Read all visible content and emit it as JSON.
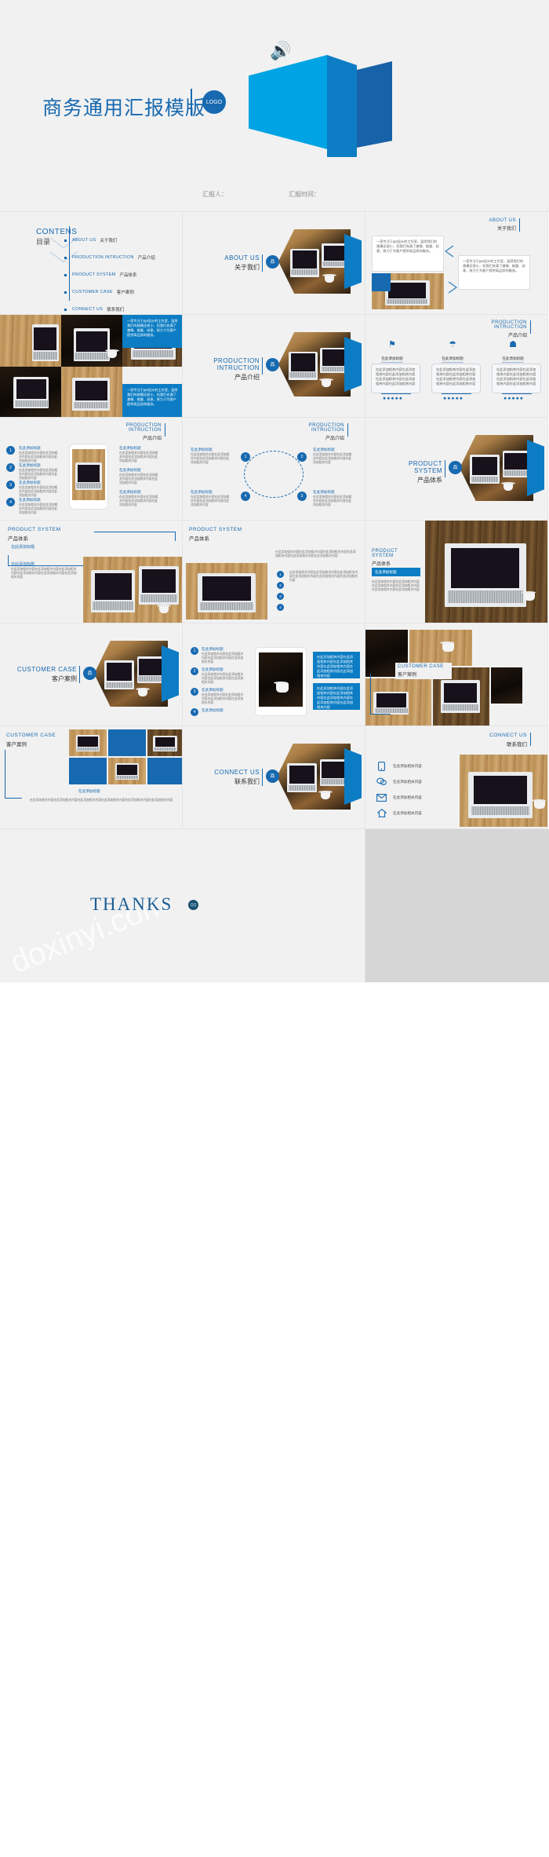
{
  "brand": {
    "accent": "#1769b0",
    "cyan": "#00a4e4",
    "mid_blue": "#0c7dc4",
    "bg": "#f1f1f1"
  },
  "title_slide": {
    "title": "商务通用汇报模版",
    "logo": "LOGO",
    "speaker_label": "汇报人：",
    "date_label": "汇报时间：",
    "speaker_icon": "speaker-icon"
  },
  "contents_slide": {
    "heading_en": "CONTENS",
    "heading_cn": "目录",
    "items": [
      {
        "en": "ABOUT US",
        "cn": "关于我们"
      },
      {
        "en": "PRODUCTION  INTRUCTION",
        "cn": "产品介绍"
      },
      {
        "en": "PRODUCT SYSTEM",
        "cn": "产品体系"
      },
      {
        "en": "CUSTOMER CASE",
        "cn": "客户案例"
      },
      {
        "en": "CONNECT US",
        "cn": "联系我们"
      }
    ]
  },
  "sections": {
    "about": {
      "en": "ABOUT US",
      "cn": "关于我们",
      "badge": "品"
    },
    "production": {
      "en": "PRODUCTION  INTRUCTION",
      "cn": "产品介绍",
      "badge": "品"
    },
    "product_system": {
      "en": "PRODUCT SYSTEM",
      "cn": "产品体系",
      "badge": "品"
    },
    "customer_case": {
      "en": "CUSTOMER CASE",
      "cn": "客户案例",
      "badge": "品"
    },
    "connect_us": {
      "en": "CONNECT US",
      "cn": "联系我们",
      "badge": "品"
    }
  },
  "placeholders": {
    "title": "在此添加标题",
    "body_short": "在此添加相关内容",
    "body_long": "在此添加相关内容在此添加相关内容在此添加相关内容在此添加相关内容",
    "body_block": "在此添加相关内容在此添加相关内容在此添加相关内容在此添加相关内容在此添加相关内容在此添加相关内容",
    "about_text": "一家专注于ppt设计的工作室，虽然我们的规模还很小，但我们充满了激情、能量、创意，致力于为客户提供高品质的服务。",
    "stars": "✹✹✹✹✹"
  },
  "contact": {
    "rows": [
      {
        "icon": "phone-icon",
        "glyph": "▯",
        "text": "在此添加相关内容"
      },
      {
        "icon": "chat-icon",
        "glyph": "◌",
        "text": "在此添加相关内容"
      },
      {
        "icon": "mail-icon",
        "glyph": "✉",
        "text": "在此添加相关内容"
      },
      {
        "icon": "home-icon",
        "glyph": "⌂",
        "text": "在此添加相关内容"
      }
    ]
  },
  "thanks_slide": {
    "text": "THANKS",
    "badge": "QQ",
    "watermark": "doxinyi.com"
  },
  "numbered_list": {
    "numbers": [
      "1",
      "2",
      "3",
      "4"
    ]
  },
  "dashed_nodes": {
    "labels": [
      "1",
      "2",
      "3",
      "4"
    ]
  }
}
